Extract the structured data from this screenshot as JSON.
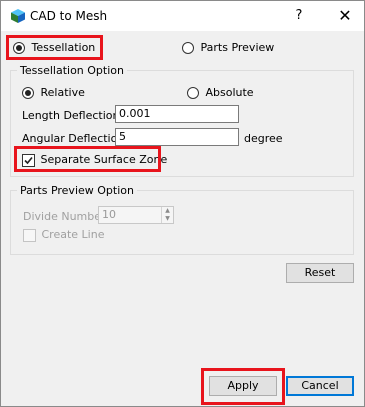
{
  "window": {
    "title": "CAD to Mesh",
    "help_label": "?",
    "close_label": "✕",
    "icon": "cad-cube-icon"
  },
  "mode": {
    "tessellation_label": "Tessellation",
    "tessellation_selected": true,
    "parts_preview_label": "Parts Preview",
    "parts_preview_selected": false
  },
  "tessellation_option": {
    "group_title": "Tessellation Option",
    "relative_label": "Relative",
    "relative_selected": true,
    "absolute_label": "Absolute",
    "absolute_selected": false,
    "length_deflection_label": "Length Deflection",
    "length_deflection_value": "0.001",
    "angular_deflection_label": "Angular Deflection",
    "angular_deflection_value": "5",
    "angular_unit": "degree",
    "separate_surface_zone_label": "Separate Surface Zone",
    "separate_surface_zone_checked": true
  },
  "parts_preview_option": {
    "group_title": "Parts Preview Option",
    "divide_number_label": "Divide Number",
    "divide_number_value": "10",
    "create_line_label": "Create Line",
    "create_line_checked": false
  },
  "buttons": {
    "reset_label": "Reset",
    "apply_label": "Apply",
    "cancel_label": "Cancel"
  },
  "colors": {
    "highlight": "#e8141c",
    "accent": "#0078d7"
  }
}
